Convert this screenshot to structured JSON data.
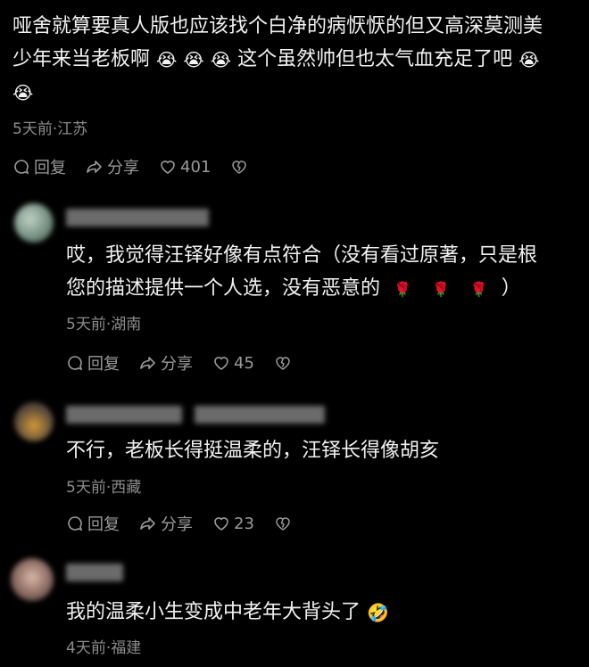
{
  "comments": [
    {
      "id": "c1",
      "line1": "哑舍就算要真人版也应该找个白净的病恹恹的但又高深莫测美",
      "line2": "少年来当老板啊",
      "line2b": "这个虽然帅但也太气血充足了吧",
      "location_time": "5天前·江苏",
      "reply_label": "回复",
      "share_label": "分享",
      "likes": "401"
    },
    {
      "id": "c2",
      "line1": "哎，我觉得汪铎好像有点符合（没有看过原著，只是根",
      "line2": "您的描述提供一个人选，没有恶意的",
      "line2_end": "）",
      "location_time": "5天前·湖南",
      "reply_label": "回复",
      "share_label": "分享",
      "likes": "45"
    },
    {
      "id": "c3",
      "line1": "不行，老板长得挺温柔的，汪铎长得像胡亥",
      "location_time": "5天前·西藏",
      "reply_label": "回复",
      "share_label": "分享",
      "likes": "23"
    },
    {
      "id": "c4",
      "line1": "我的温柔小生变成中老年大背头了",
      "location_time": "4天前·福建"
    }
  ],
  "icons": {
    "crying": "😭",
    "rose": "🌹",
    "rofl": "🤣"
  }
}
